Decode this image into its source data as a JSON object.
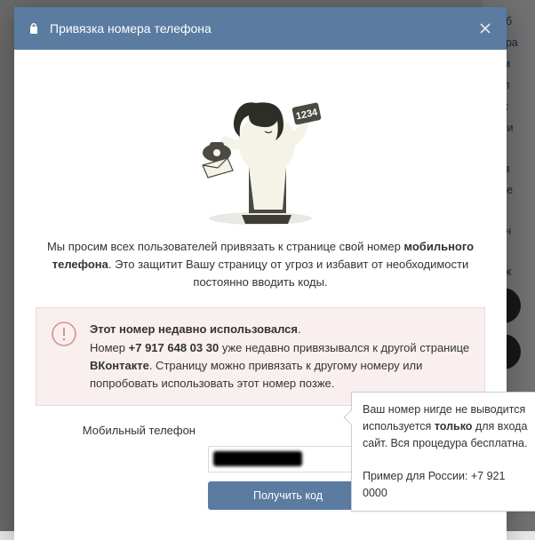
{
  "header": {
    "title": "Привязка номера телефона"
  },
  "intro": {
    "prefix": "Мы просим всех пользователей привязать к странице свой номер ",
    "bold": "мобильного телефона",
    "suffix": ". Это защитит Вашу страницу от угроз и избавит от необходимости постоянно вводить коды."
  },
  "warning": {
    "line1_bold": "Этот номер недавно использовался",
    "line1_suffix": ".",
    "line2_prefix": "Номер ",
    "line2_number": "+7 917 648 03 30",
    "line2_mid": " уже недавно привязывался к другой странице ",
    "line2_brand": "ВКонтакте",
    "line2_suffix": ". Страницу можно привязать к другому номеру или попробовать использовать этот номер позже."
  },
  "form": {
    "label": "Мобильный телефон",
    "phone_value": "",
    "submit_label": "Получить код"
  },
  "tooltip": {
    "line1_a": "Ваш номер нигде не выводится",
    "line1_b": "используется ",
    "line1_bold": "только",
    "line1_c": " для входа",
    "line1_d": "сайт. Вся процедура бесплатна.",
    "example": "Пример для России: +7 921 0000"
  },
  "bg": {
    "items": [
      "Сооб",
      "Понра",
      "еком",
      "ансл",
      "оиск",
      "татьи",
      "бнов",
      "омме",
      "Снач",
      "змож"
    ]
  }
}
